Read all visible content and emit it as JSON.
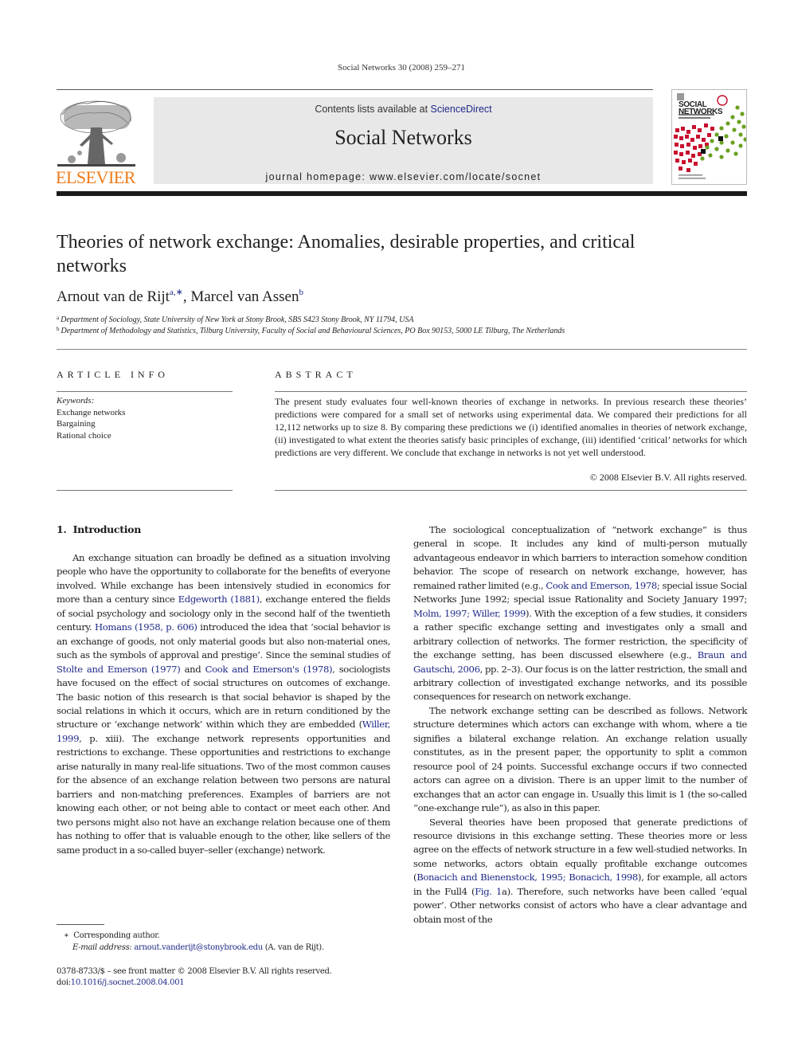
{
  "running_head": "Social Networks 30 (2008) 259–271",
  "masthead": {
    "contents_prefix": "Contents lists available at ",
    "contents_link": "ScienceDirect",
    "journal_name": "Social Networks",
    "homepage": "journal homepage: www.elsevier.com/locate/socnet",
    "publisher_logo_text": "ELSEVIER",
    "cover_title_line1": "SOCIAL",
    "cover_title_line2": "NETWORKS"
  },
  "colors": {
    "link": "#1f2a86",
    "elsevier_orange": "#f07b19",
    "masthead_bg": "#e8e8e9",
    "cover_red": "#c8102e",
    "cover_green": "#6aa121"
  },
  "article": {
    "title": "Theories of network exchange: Anomalies, desirable properties, and critical networks",
    "authors": [
      {
        "name": "Arnout van de Rijt",
        "marks": "a,∗"
      },
      {
        "name": "Marcel van Assen",
        "marks": "b"
      }
    ],
    "author_separator": ", ",
    "affiliations": [
      {
        "mark": "a",
        "text": "Department of Sociology, State University of New York at Stony Brook, SBS S423 Stony Brook, NY 11794, USA"
      },
      {
        "mark": "b",
        "text": "Department of Methodology and Statistics, Tilburg University, Faculty of Social and Behavioural Sciences, PO Box 90153, 5000 LE Tilburg, The Netherlands"
      }
    ]
  },
  "article_info": {
    "heading": "ARTICLE INFO",
    "keywords_label": "Keywords:",
    "keywords": [
      "Exchange networks",
      "Bargaining",
      "Rational choice"
    ]
  },
  "abstract": {
    "heading": "ABSTRACT",
    "text": "The present study evaluates four well-known theories of exchange in networks. In previous research these theories’ predictions were compared for a small set of networks using experimental data. We compared their predictions for all 12,112 networks up to size 8. By comparing these predictions we (i) identified anomalies in theories of network exchange, (ii) investigated to what extent the theories satisfy basic principles of exchange, (iii) identified ‘critical’ networks for which predictions are very different. We conclude that exchange in networks is not yet well understood.",
    "copyright": "© 2008 Elsevier B.V. All rights reserved."
  },
  "section": {
    "number": "1.",
    "title": "Introduction"
  },
  "body": {
    "p1": [
      {
        "t": "An exchange situation can broadly be defined as a situation involving people who have the opportunity to collaborate for the benefits of everyone involved. While exchange has been intensively studied in economics for more than a century since "
      },
      {
        "t": "Edgeworth (1881)",
        "link": true
      },
      {
        "t": ", exchange entered the fields of social psychology and sociology only in the second half of the twentieth century. "
      },
      {
        "t": "Homans (1958, p. 606)",
        "link": true
      },
      {
        "t": " introduced the idea that ‘social behavior is an exchange of goods, not only material goods but also non-material ones, such as the symbols of approval and prestige’. Since the seminal studies of "
      },
      {
        "t": "Stolte and Emerson (1977)",
        "link": true
      },
      {
        "t": " and "
      },
      {
        "t": "Cook and Emerson's (1978)",
        "link": true
      },
      {
        "t": ", sociologists have focused on the effect of social structures on outcomes of exchange. The basic notion of this research is that social behavior is shaped by the social relations in which it occurs, which are in return conditioned by the structure or ‘exchange network’ within which they are embedded ("
      },
      {
        "t": "Willer, 1999",
        "link": true
      },
      {
        "t": ", p. xiii). The exchange network represents opportunities and restrictions to exchange. These opportunities and restrictions to exchange arise naturally in many real-life situations. Two of the most common causes for the absence of an exchange relation between two persons are natural barriers and non-matching preferences. Examples of barriers are not knowing each other, or not being able to contact or meet each other. And two persons might also not have an exchange relation because one of them has nothing to offer that is valuable enough to the other, like sellers of the same product in a so-called buyer–seller (exchange) network."
      }
    ],
    "p2": [
      {
        "t": "The sociological conceptualization of “network exchange” is thus general in scope. It includes any kind of multi-person mutually advantageous endeavor in which barriers to interaction somehow condition behavior. The scope of research on network exchange, however, has remained rather limited (e.g., "
      },
      {
        "t": "Cook and Emerson, 1978",
        "link": true
      },
      {
        "t": "; special issue Social Networks June 1992; special issue Rationality and Society January 1997; "
      },
      {
        "t": "Molm, 1997; Willer, 1999",
        "link": true
      },
      {
        "t": "). With the exception of a few studies, it considers a rather specific exchange setting and investigates only a small and arbitrary collection of networks. The former restriction, the specificity of the exchange setting, has been discussed elsewhere (e.g., "
      },
      {
        "t": "Braun and Gautschi, 2006",
        "link": true
      },
      {
        "t": ", pp. 2–3). Our focus is on the latter restriction, the small and arbitrary collection of investigated exchange networks, and its possible consequences for research on network exchange."
      }
    ],
    "p3": [
      {
        "t": "The network exchange setting can be described as follows. Network structure determines which actors can exchange with whom, where a tie signifies a bilateral exchange relation. An exchange relation usually constitutes, as in the present paper, the opportunity to split a common resource pool of 24 points. Successful exchange occurs if two connected actors can agree on a division. There is an upper limit to the number of exchanges that an actor can engage in. Usually this limit is 1 (the so-called “one-exchange rule”), as also in this paper."
      }
    ],
    "p4": [
      {
        "t": "Several theories have been proposed that generate predictions of resource divisions in this exchange setting. These theories more or less agree on the effects of network structure in a few well-studied networks. In some networks, actors obtain equally profitable exchange outcomes ("
      },
      {
        "t": "Bonacich and Bienenstock, 1995; Bonacich, 1998",
        "link": true
      },
      {
        "t": "), for example, all actors in the Full4 ("
      },
      {
        "t": "Fig. 1",
        "link": true
      },
      {
        "t": "a). Therefore, such networks have been called ‘equal power’. Other networks consist of actors who have a clear advantage and obtain most of the"
      }
    ]
  },
  "footnotes": {
    "corresponding_mark": "∗",
    "corresponding_text": "Corresponding author.",
    "email_label": "E-mail address:",
    "email": "arnout.vanderijt@stonybrook.edu",
    "email_suffix": " (A. van de Rijt).",
    "issn_line": "0378-8733/$ – see front matter © 2008 Elsevier B.V. All rights reserved.",
    "doi_prefix": "doi:",
    "doi": "10.1016/j.socnet.2008.04.001"
  }
}
